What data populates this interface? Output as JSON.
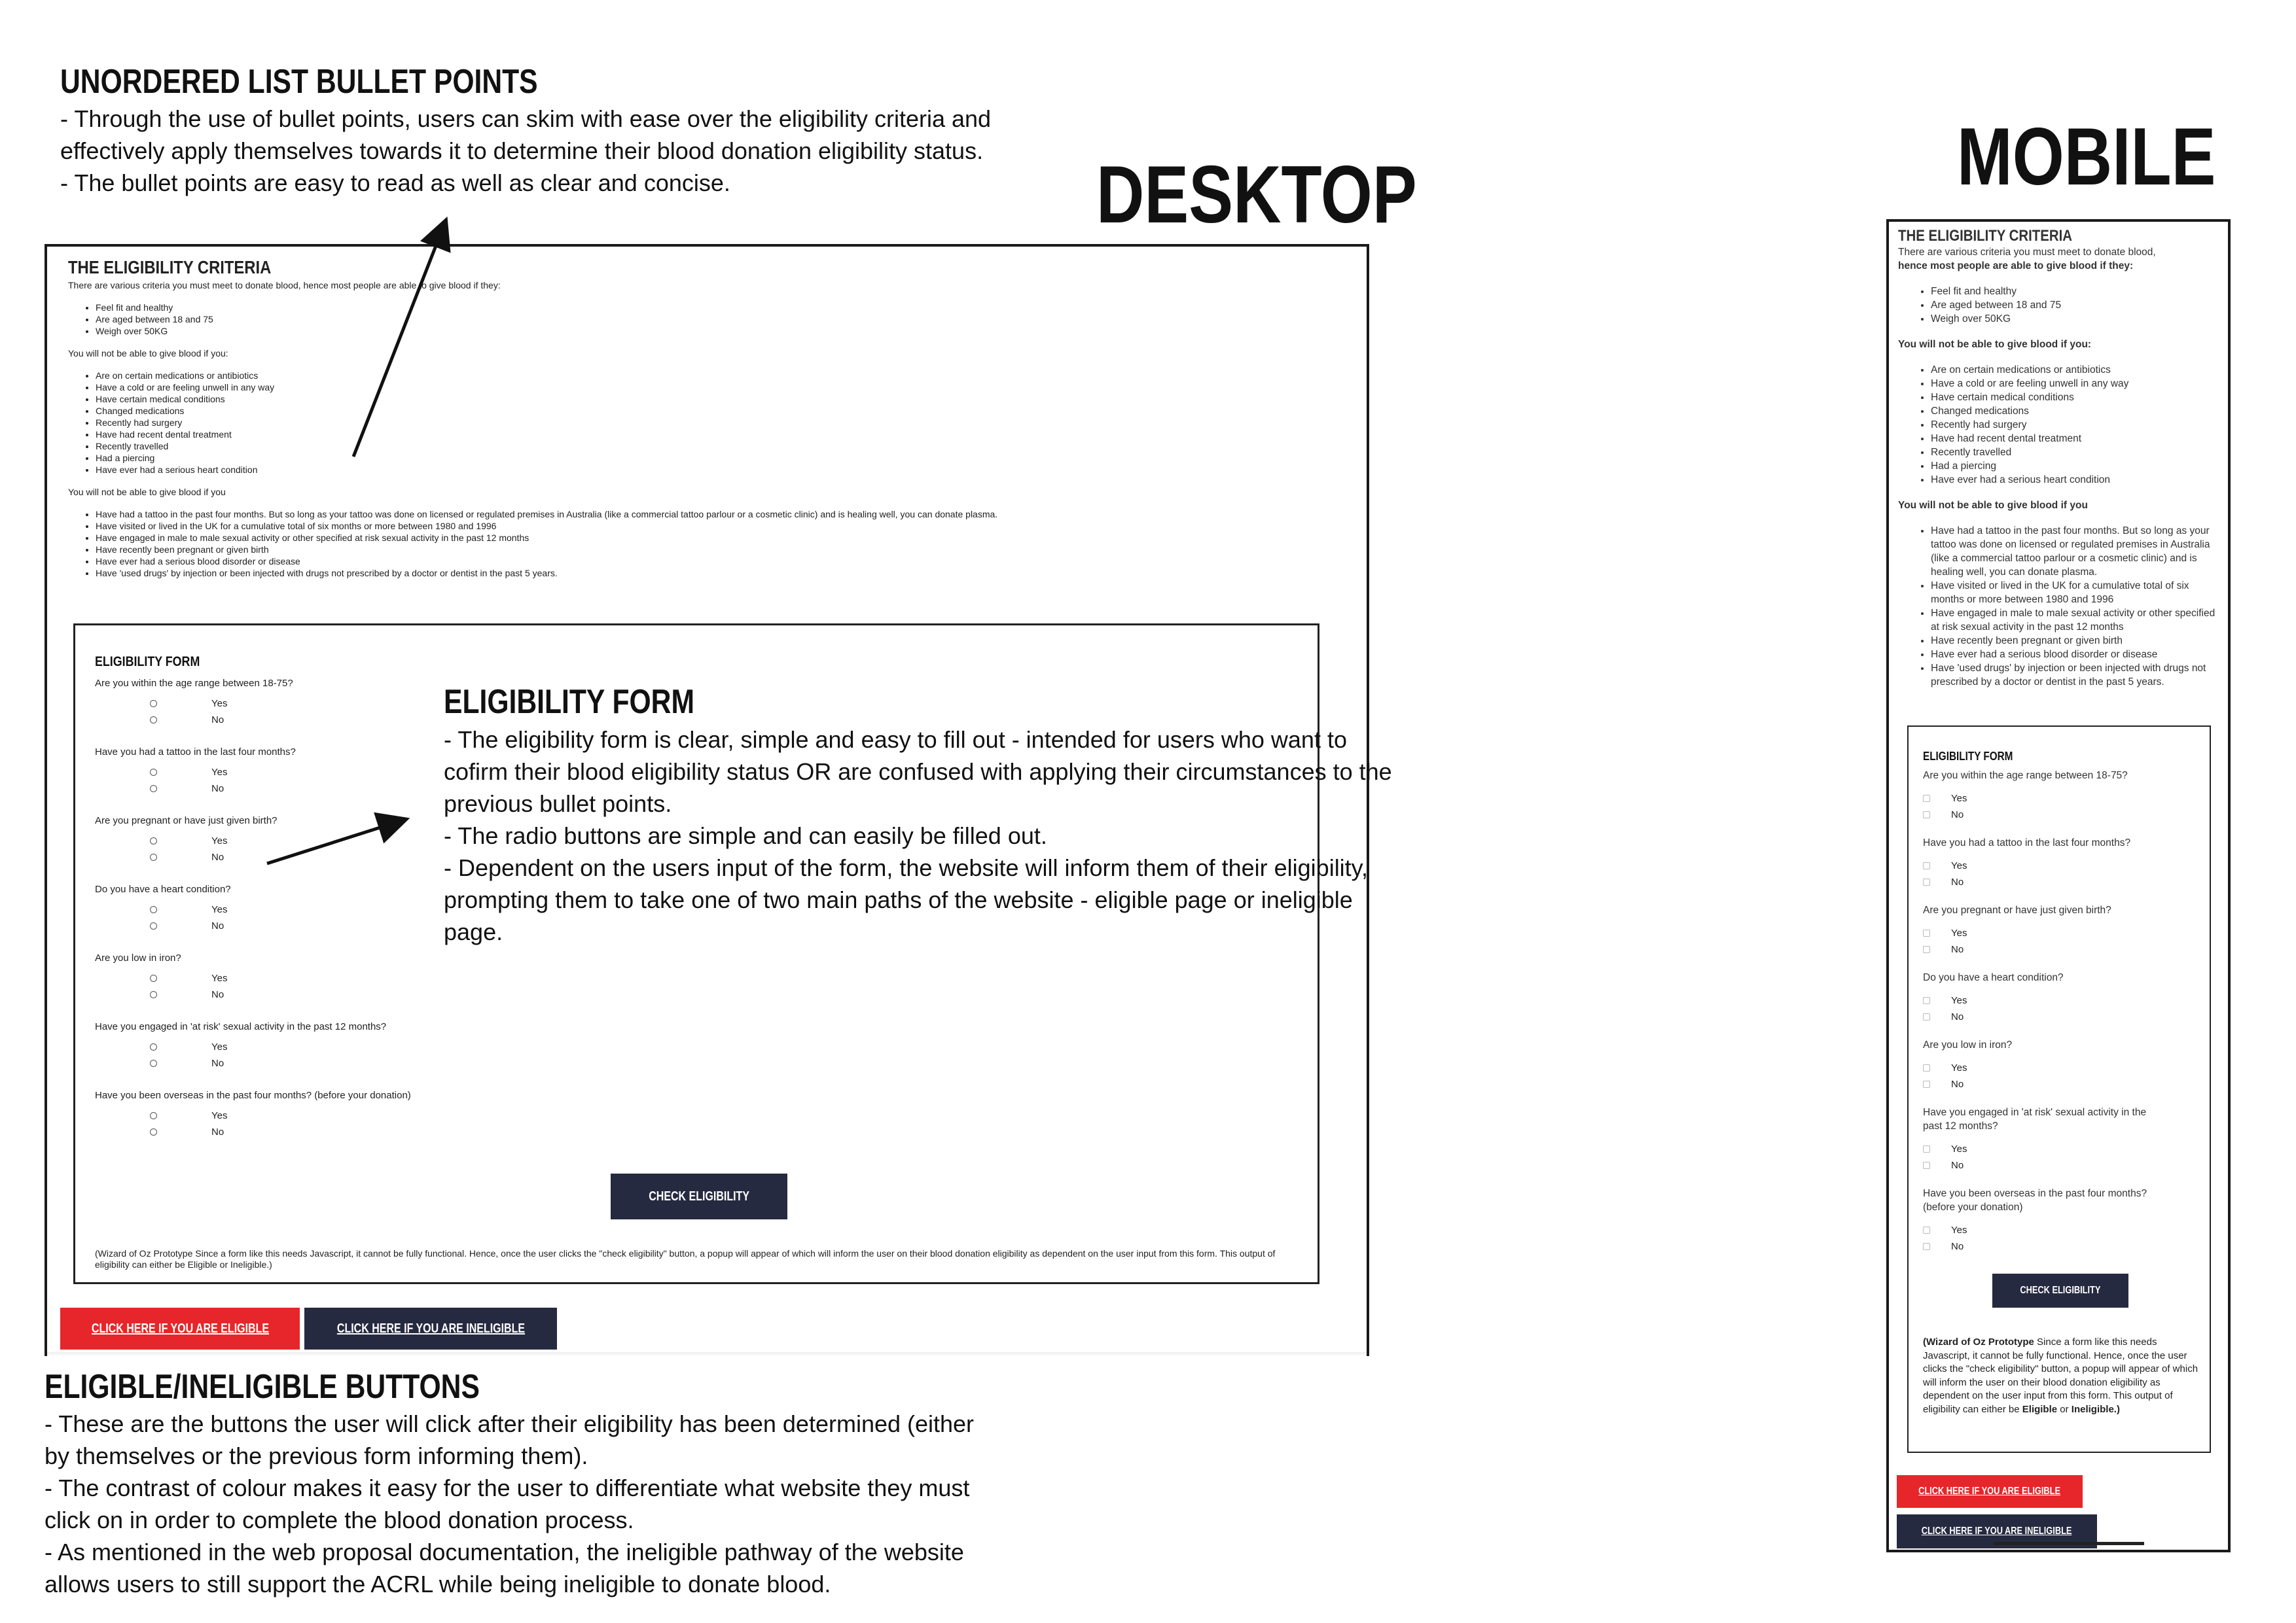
{
  "labels": {
    "desktop": "DESKTOP",
    "mobile": "MOBILE"
  },
  "annotations": {
    "bullets": {
      "title": "UNORDERED LIST BULLET POINTS",
      "lines": [
        "- Through the use of bullet points, users can skim with ease over the eligibility criteria and",
        "effectively apply themselves towards it to determine their blood donation eligibility status.",
        "- The bullet points are easy to read as well as clear and concise."
      ]
    },
    "form": {
      "title": "ELIGIBILITY FORM",
      "lines": [
        "- The eligibility form is clear, simple and easy to fill out - intended for users who want to",
        "cofirm their blood eligibility status OR are confused with applying their circumstances to the",
        "previous bullet points.",
        "- The radio buttons are simple and can easily be filled out.",
        "- Dependent on the users input of the form, the website will inform them of their eligibility,",
        "prompting them to take one of two main paths of the website - eligible page or ineligible",
        "page."
      ]
    },
    "buttons": {
      "title": "ELIGIBLE/INELIGIBLE BUTTONS",
      "lines": [
        "- These are the buttons the user will click after their eligibility has been determined (either",
        "by themselves or the previous form informing them).",
        "- The contrast of colour makes it easy for the user to differentiate what website they must",
        "click on in order to complete the blood donation process.",
        "- As mentioned in the web proposal documentation, the ineligible pathway of the website",
        "allows users to still support the ACRL while being ineligible to donate blood."
      ]
    }
  },
  "criteria": {
    "title": "THE ELIGIBILITY CRITERIA",
    "intro": "There are various criteria you must meet to donate blood, hence most people are able to give blood if they:",
    "mobile_intro_a": "There are various criteria you must meet to donate blood,",
    "mobile_intro_b": "hence most people are able to give blood if they:",
    "can_items": [
      "Feel fit and healthy",
      "Are aged between 18 and 75",
      "Weigh over 50KG"
    ],
    "cannot_heading": "You will not be able to give blood if you:",
    "cannot_items": [
      "Are on certain medications or antibiotics",
      "Have a cold or are feeling unwell in any way",
      "Have certain medical conditions",
      "Changed medications",
      "Recently had surgery",
      "Have had recent dental treatment",
      "Recently travelled",
      "Had a piercing",
      "Have ever had a serious heart condition"
    ],
    "cannot_heading_2": "You will not be able to give blood if you",
    "cannot_items_2": [
      "Have had a tattoo in the past four months. But so long as your tattoo was done on licensed or regulated premises in Australia (like a commercial tattoo parlour or a cosmetic clinic) and is healing well, you can donate plasma.",
      "Have visited or lived in the UK for a cumulative total of six months or more between 1980 and 1996",
      "Have engaged in male to male sexual activity or other specified at risk sexual activity in the past 12 months",
      "Have recently been pregnant or given birth",
      "Have ever had a serious blood disorder or disease",
      "Have 'used drugs' by injection or been injected with drugs not prescribed by a doctor or dentist in the past 5 years."
    ]
  },
  "form": {
    "title": "ELIGIBILITY FORM",
    "yes": "Yes",
    "no": "No",
    "questions": [
      "Are you within the age range between 18-75?",
      "Have you had a tattoo in the last four months?",
      "Are you pregnant or have just given birth?",
      "Do you have a heart condition?",
      "Are you low in iron?",
      "Have you engaged in 'at risk' sexual activity in the past 12 months?",
      "Have you been overseas in the past four months? (before your donation)"
    ],
    "mobile_q6_a": "Have you engaged in 'at risk' sexual activity in the",
    "mobile_q6_b": "past 12 months?",
    "mobile_q7_a": "Have you been overseas in the past four months?",
    "mobile_q7_b": "(before your donation)",
    "check_button": "CHECK ELIGIBILITY",
    "note": "(Wizard of Oz Prototype Since a form like this needs Javascript, it cannot be fully functional. Hence, once the user clicks the \"check eligibility\" button, a popup will appear of which will inform the user on their blood donation eligibility as dependent on the user input from this form. This output of eligibility can either be Eligible or Ineligible.)",
    "mobile_note_bold": "(Wizard of Oz Prototype",
    "mobile_note_rest": " Since a form like this needs Javascript, it cannot be fully functional. Hence, once the user clicks the \"check eligibility\" button, a popup will appear of which will inform the user on their blood donation eligibility as dependent on the user input from this form. This output of eligibility can either be ",
    "mobile_note_eligible": "Eligible",
    "mobile_note_or": " or ",
    "mobile_note_ineligible": "Ineligible.)"
  },
  "buttons": {
    "eligible": "CLICK HERE IF YOU ARE ELIGIBLE",
    "ineligible": "CLICK HERE IF YOU ARE INELIGIBLE"
  },
  "colors": {
    "red": "#e6262a",
    "navy": "#262a40"
  }
}
